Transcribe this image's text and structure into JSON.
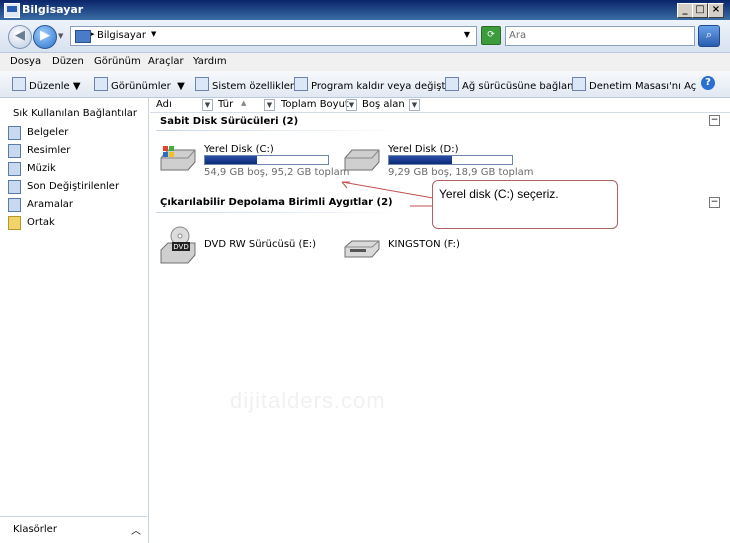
{
  "window": {
    "title": "Bilgisayar"
  },
  "address": {
    "location": "Bilgisayar",
    "search_placeholder": "Ara"
  },
  "menu": [
    "Dosya",
    "Düzen",
    "Görünüm",
    "Araçlar",
    "Yardım"
  ],
  "toolbar": {
    "organize": "Düzenle",
    "views": "Görünümler",
    "system_properties": "Sistem özellikleri",
    "uninstall": "Program kaldır veya değiştir",
    "map_drive": "Ağ sürücüsüne bağlan",
    "control_panel": "Denetim Masası'nı Aç"
  },
  "sidebar": {
    "header": "Sık Kullanılan Bağlantılar",
    "items": [
      "Belgeler",
      "Resimler",
      "Müzik",
      "Son Değiştirilenler",
      "Aramalar",
      "Ortak"
    ],
    "footer": "Klasörler"
  },
  "columns": [
    "Adı",
    "Tür",
    "Toplam Boyut",
    "Boş alan"
  ],
  "groups": {
    "fixed": "Sabit Disk Sürücüleri (2)",
    "removable": "Çıkarılabilir Depolama Birimli Aygıtlar (2)"
  },
  "drives": [
    {
      "name": "Yerel Disk (C:)",
      "info": "54,9 GB boş, 95,2 GB toplam",
      "used_fraction": 0.42
    },
    {
      "name": "Yerel Disk (D:)",
      "info": "9,29 GB boş, 18,9 GB toplam",
      "used_fraction": 0.51
    }
  ],
  "removable": [
    {
      "name": "DVD RW Sürücüsü (E:)",
      "badge": "DVD"
    },
    {
      "name": "KINGSTON (F:)"
    }
  ],
  "callout": "Yerel disk (C:) seçeriz.",
  "watermark": "dijitalders.com"
}
